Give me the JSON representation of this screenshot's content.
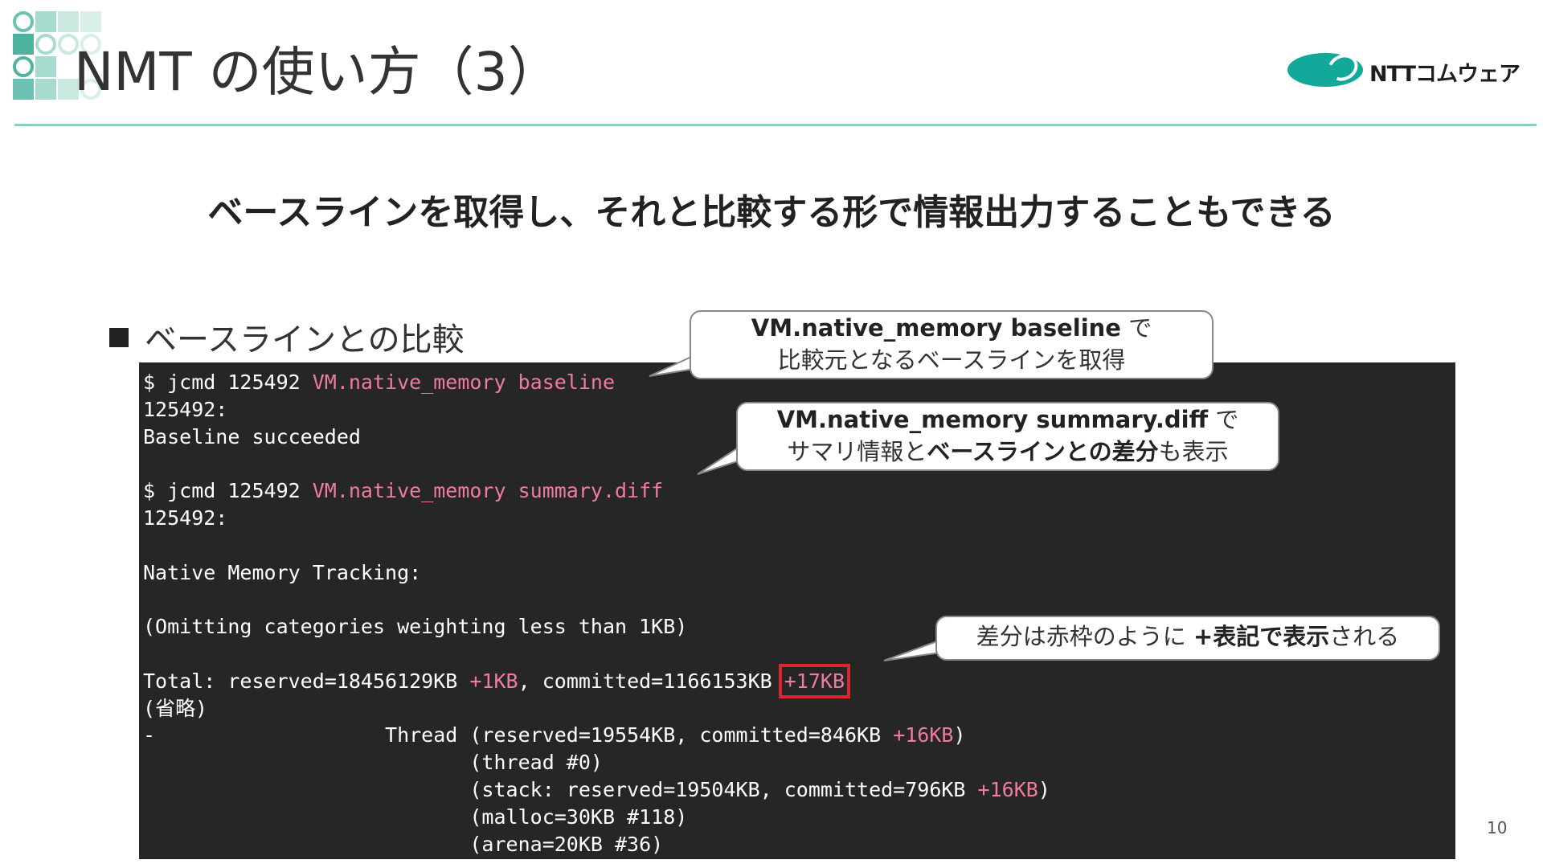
{
  "header": {
    "title": "NMT の使い方（3）",
    "logo_text": "NTTコムウェア"
  },
  "subtitle": "ベースラインを取得し、それと比較する形で情報出力することもできる",
  "bullet": "ベースラインとの比較",
  "terminal": {
    "cmd1_prefix": "$ jcmd 125492 ",
    "cmd1_arg": "VM.native_memory baseline",
    "line_pid1": "125492:",
    "line_baseline_ok": "Baseline succeeded",
    "cmd2_prefix": "$ jcmd 125492 ",
    "cmd2_arg": "VM.native_memory summary.diff",
    "line_pid2": "125492:",
    "line_nmt": "Native Memory Tracking:",
    "line_omit": "(Omitting categories weighting less than 1KB)",
    "total_prefix": "Total: reserved=18456129KB ",
    "total_diff1": "+1KB",
    "total_mid": ", committed=1166153KB ",
    "total_diff2": "+17KB",
    "line_omitted": "(省略)",
    "thread_prefix": "-                   Thread (reserved=19554KB, committed=846KB ",
    "thread_diff": "+16KB",
    "thread_suffix": ")",
    "thread_count": "                           (thread #0)",
    "stack_prefix": "                           (stack: reserved=19504KB, committed=796KB ",
    "stack_diff": "+16KB",
    "stack_suffix": ")",
    "malloc_line": "                           (malloc=30KB #118)",
    "arena_line": "                           (arena=20KB #36)"
  },
  "callouts": {
    "baseline": {
      "line1_bold": "VM.native_memory baseline",
      "line1_tail": " で",
      "line2": "比較元となるベースラインを取得"
    },
    "summary_diff": {
      "line1_bold": "VM.native_memory summary.diff",
      "line1_tail": " で",
      "line2_pre": "サマリ情報と",
      "line2_bold": "ベースラインとの差分",
      "line2_post": "も表示"
    },
    "red_box": {
      "pre": "差分は赤枠のように ",
      "bold": "+表記で表示",
      "post": "される"
    }
  },
  "page_number": "10",
  "colors": {
    "accent_teal": "#12a89a",
    "rule": "#8ecdc0",
    "terminal_bg": "#262626",
    "highlight_pink": "#f07c9c",
    "red_box": "#d8262c"
  }
}
